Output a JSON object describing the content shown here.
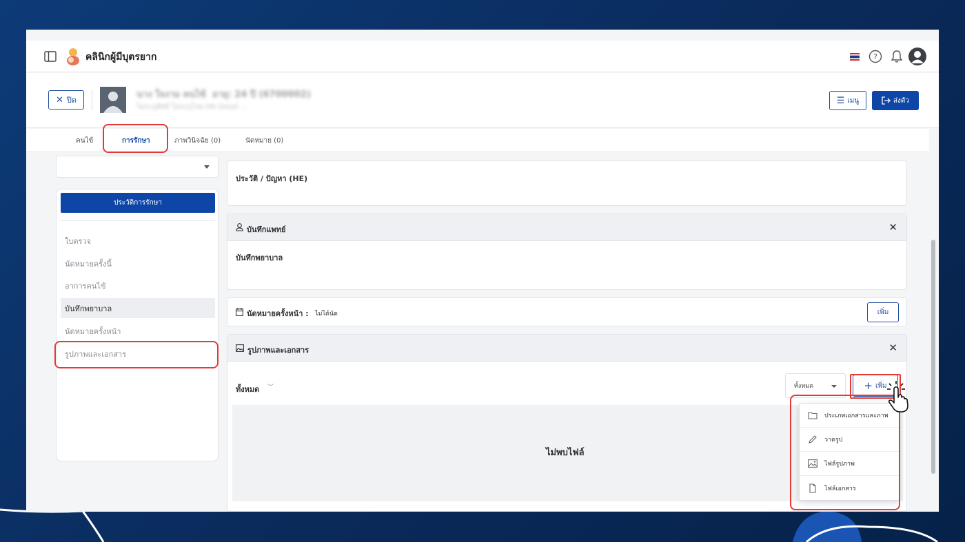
{
  "app": {
    "title": "คลินิกผู้มีบุตรยาก"
  },
  "patient_bar": {
    "close_label": "ปิด",
    "patient_name": "นาง ใจงาม คนไข้",
    "patient_age": "อายุ: 24 ปี (6700002)",
    "patient_sub": "ไม่ระบุสิทธิ  ไม่ระบุโรค  HN Detail ...",
    "menu_label": "เมนู",
    "send_label": "ส่งตัว"
  },
  "tabs": [
    {
      "label": "คนไข้"
    },
    {
      "label": "การรักษา"
    },
    {
      "label": "ภาพวินิจฉัย (0)"
    },
    {
      "label": "นัดหมาย (0)"
    }
  ],
  "left_panel": {
    "history_button": "ประวัติการรักษา",
    "items": [
      {
        "label": "ใบตรวจ"
      },
      {
        "label": "นัดหมายครั้งนี้"
      },
      {
        "label": "อาการคนไข้"
      },
      {
        "label": "บันทึกพยาบาล"
      },
      {
        "label": "นัดหมายครั้งหน้า"
      },
      {
        "label": "รูปภาพและเอกสาร"
      }
    ]
  },
  "history_card": {
    "title": "ประวัติ / ปัญหา (HE)"
  },
  "doctor_card": {
    "title": "บันทึกแพทย์",
    "body_title": "บันทึกพยาบาล",
    "close": "✕"
  },
  "appointment_card": {
    "title": "นัดหมายครั้งหน้า :",
    "status": "ไม่ได้นัด",
    "add_label": "เพิ่ม"
  },
  "images_card": {
    "title": "รูปภาพและเอกสาร",
    "close": "✕",
    "filter_label": "ทั้งหมด",
    "select_value": "ทั้งหมด",
    "add_label": "เพิ่ม",
    "empty_text": "ไม่พบไฟล์"
  },
  "dropdown": {
    "items": [
      {
        "label": "ประเภทเอกสารและภาพ",
        "icon": "folder-icon"
      },
      {
        "label": "วาดรูป",
        "icon": "pen-icon"
      },
      {
        "label": "ไฟล์รูปภาพ",
        "icon": "image-icon"
      },
      {
        "label": "ไฟล์เอกสาร",
        "icon": "file-icon"
      }
    ]
  },
  "colors": {
    "primary": "#0e46a8",
    "highlight": "#e53935",
    "background": "#0d3b78"
  }
}
